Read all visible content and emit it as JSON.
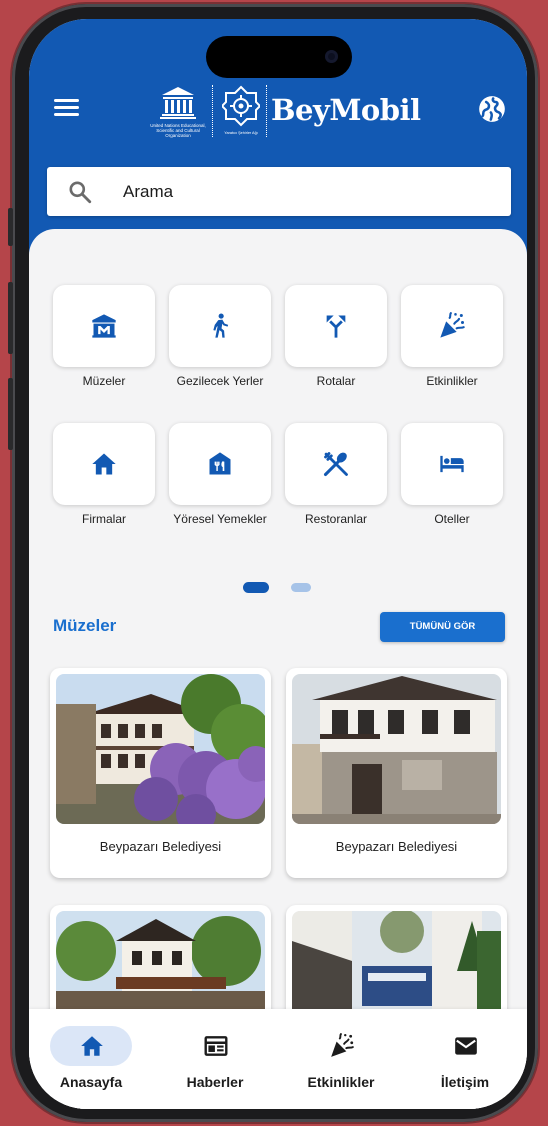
{
  "app": {
    "brand": "BeyMobil",
    "unesco_text": "United Nations Educational, Scientific and Cultural Organization",
    "emblem_text": "Yaratıcı Şehirler Ağı",
    "colors": {
      "primary": "#1259b3",
      "accent": "#1a6fce",
      "background": "#f4f4f5"
    }
  },
  "header": {
    "menu_icon": "hamburger-menu-icon",
    "language_icon": "globe-icon"
  },
  "search": {
    "placeholder": "Arama",
    "icon": "search-icon"
  },
  "categories": [
    {
      "label": "Müzeler",
      "icon": "museum-icon"
    },
    {
      "label": "Gezilecek Yerler",
      "icon": "hiking-icon"
    },
    {
      "label": "Rotalar",
      "icon": "routes-icon"
    },
    {
      "label": "Etkinlikler",
      "icon": "celebration-icon"
    },
    {
      "label": "Firmalar",
      "icon": "home-icon"
    },
    {
      "label": "Yöresel Yemekler",
      "icon": "local-dining-icon"
    },
    {
      "label": "Restoranlar",
      "icon": "restaurant-icon"
    },
    {
      "label": "Oteller",
      "icon": "hotel-icon"
    }
  ],
  "pager": {
    "pages": 2,
    "current": 1
  },
  "museums_section": {
    "title": "Müzeler",
    "see_all_label": "TÜMÜNÜ GÖR",
    "cards": [
      {
        "title": "Beypazarı Belediyesi"
      },
      {
        "title": "Beypazarı Belediyesi"
      },
      {
        "title": ""
      },
      {
        "title": ""
      }
    ]
  },
  "bottom_nav": [
    {
      "label": "Anasayfa",
      "icon": "home-icon",
      "active": true
    },
    {
      "label": "Haberler",
      "icon": "newspaper-icon",
      "active": false
    },
    {
      "label": "Etkinlikler",
      "icon": "celebration-icon",
      "active": false
    },
    {
      "label": "İletişim",
      "icon": "mail-icon",
      "active": false
    }
  ]
}
